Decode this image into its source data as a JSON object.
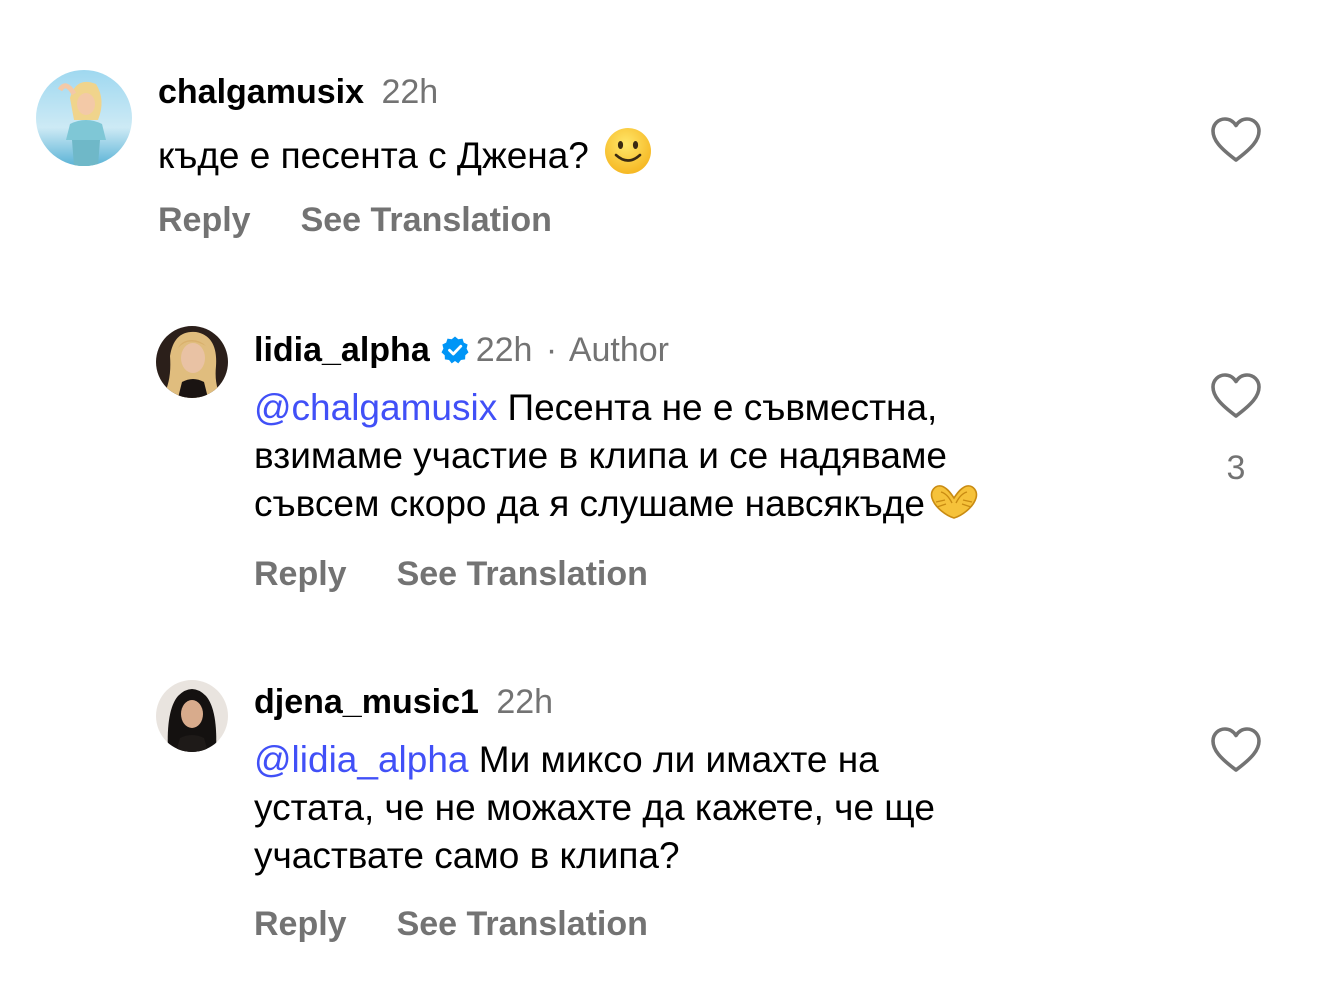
{
  "comments": [
    {
      "username": "chalgamusix",
      "time": "22h",
      "text": "къде е песента с Джена?",
      "emoji": "smiling-face",
      "reply_label": "Reply",
      "translate_label": "See Translation",
      "like_icon": "heart-outline-icon"
    },
    {
      "username": "lidia_alpha",
      "verified": true,
      "time": "22h",
      "separator": "·",
      "author_label": "Author",
      "mention": "@chalgamusix",
      "lines": [
        "Песента не е съвместна,",
        "взимаме участие в клипа и се надяваме",
        "съвсем скоро да я слушаме навсякъде"
      ],
      "emoji": "heart-hands",
      "like_count": "3",
      "reply_label": "Reply",
      "translate_label": "See Translation",
      "like_icon": "heart-outline-icon"
    },
    {
      "username": "djena_music1",
      "time": "22h",
      "mention": "@lidia_alpha",
      "lines": [
        "Ми миксо ли имахте на",
        "устата, че не можахте да кажете, че ще",
        "участвате само в клипа?"
      ],
      "reply_label": "Reply",
      "translate_label": "See Translation",
      "like_icon": "heart-outline-icon"
    }
  ],
  "colors": {
    "secondary_text": "#737373",
    "mention": "#4150f7",
    "verified_badge": "#0095f6"
  }
}
